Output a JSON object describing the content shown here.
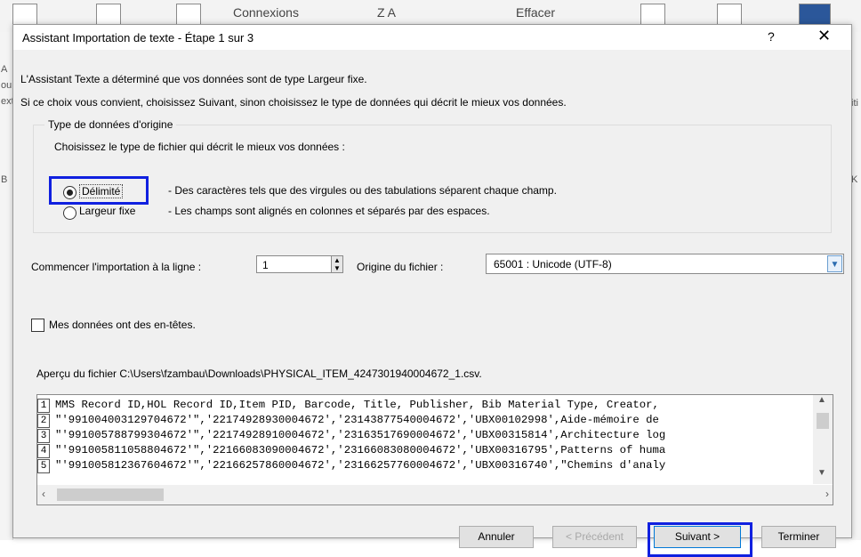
{
  "background": {
    "ribbon_connexions": "Connexions",
    "ribbon_sort": "Z A",
    "ribbon_effacer": "Effacer",
    "left_letters": [
      "A",
      "ou",
      "ext",
      "B"
    ],
    "right_letters": [
      "iti",
      "K"
    ]
  },
  "dialog": {
    "title": "Assistant Importation de texte - Étape 1 sur 3",
    "help_label": "?",
    "close_label": "✕",
    "message1": "L'Assistant Texte a déterminé que vos données sont de type Largeur fixe.",
    "message2": "Si ce choix vous convient, choisissez Suivant, sinon choisissez le type de données qui décrit le mieux vos données."
  },
  "origin_type": {
    "group_label": "Type de données d'origine",
    "choose_text": "Choisissez le type de fichier qui décrit le mieux vos données :",
    "option_delimited": "Délimité",
    "option_delimited_desc": "- Des caractères tels que des virgules ou des tabulations séparent chaque champ.",
    "option_fixed": "Largeur fixe",
    "option_fixed_desc": "- Les champs sont alignés en colonnes et séparés par des espaces.",
    "selected": "Délimité"
  },
  "import": {
    "start_label": "Commencer l'importation à la ligne :",
    "start_value": "1",
    "origin_label": "Origine du fichier :",
    "origin_value": "65001 : Unicode (UTF-8)"
  },
  "headers_checkbox": {
    "label": "Mes données ont des en-têtes.",
    "checked": false
  },
  "preview": {
    "label": "Aperçu du fichier C:\\Users\\fzambau\\Downloads\\PHYSICAL_ITEM_4247301940004672_1.csv.",
    "rows": [
      {
        "num": "1",
        "text": "MMS Record ID,HOL Record ID,Item PID, Barcode, Title, Publisher, Bib Material Type, Creator,"
      },
      {
        "num": "2",
        "text": "\"'991004003129704672'\",'22174928930004672','23143877540004672','UBX00102998',Aide-mémoire de"
      },
      {
        "num": "3",
        "text": "\"'991005788799304672'\",'22174928910004672','23163517690004672','UBX00315814',Architecture log"
      },
      {
        "num": "4",
        "text": "\"'991005811058804672'\",'22166083090004672','23166083080004672','UBX00316795',Patterns of huma"
      },
      {
        "num": "5",
        "text": "\"'991005812367604672'\",'22166257860004672','23166257760004672','UBX00316740',\"Chemins d'analy"
      }
    ]
  },
  "buttons": {
    "cancel": "Annuler",
    "previous": "< Précédent",
    "next": "Suivant >",
    "finish": "Terminer"
  },
  "colors": {
    "highlight": "#1020e0",
    "dialog_bg": "#f0f0f0"
  }
}
